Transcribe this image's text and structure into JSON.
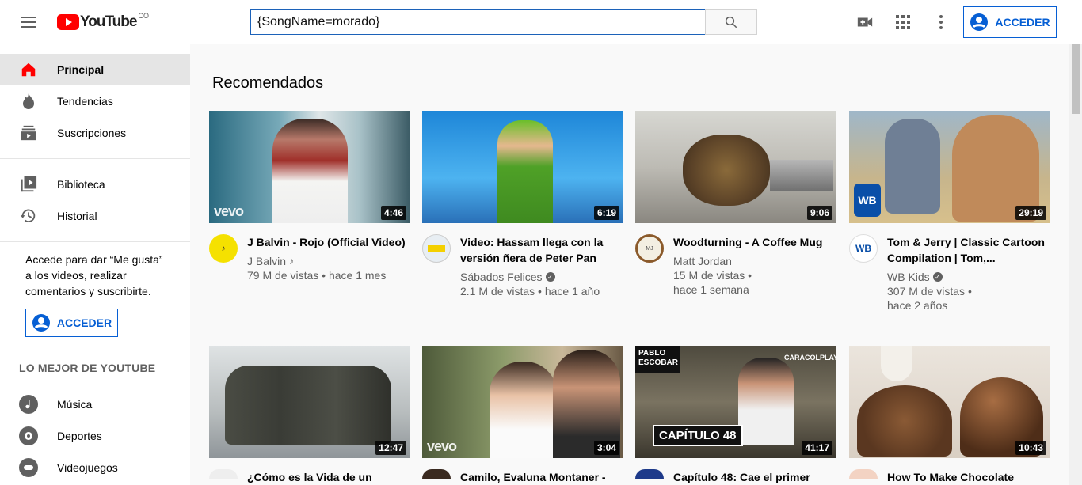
{
  "header": {
    "logo_text": "YouTube",
    "region": "CO",
    "search_value": "{SongName=morado}",
    "signin_label": "ACCEDER"
  },
  "sidebar": {
    "items": [
      {
        "label": "Principal",
        "icon": "home-icon"
      },
      {
        "label": "Tendencias",
        "icon": "trending-icon"
      },
      {
        "label": "Suscripciones",
        "icon": "subscriptions-icon"
      }
    ],
    "library_items": [
      {
        "label": "Biblioteca",
        "icon": "library-icon"
      },
      {
        "label": "Historial",
        "icon": "history-icon"
      }
    ],
    "signin_message": "Accede para dar “Me gusta” a los videos, realizar comentarios y suscribirte.",
    "signin_label": "ACCEDER",
    "best_heading": "LO MEJOR DE YOUTUBE",
    "best_items": [
      {
        "label": "Música",
        "icon": "music-icon"
      },
      {
        "label": "Deportes",
        "icon": "sports-icon"
      },
      {
        "label": "Videojuegos",
        "icon": "gaming-icon"
      }
    ]
  },
  "main": {
    "section_title": "Recomendados",
    "videos": [
      {
        "title": "J Balvin - Rojo (Official Video)",
        "channel": "J Balvin",
        "channel_badge": "music-note",
        "views": "79 M de vistas",
        "age": "hace 1 mes",
        "duration": "4:46",
        "vevo": "vevo"
      },
      {
        "title": "Video: Hassam llega con la versión ñera de Peter Pan",
        "channel": "Sábados Felices",
        "channel_badge": "verified",
        "views": "2.1 M de vistas",
        "age": "hace 1 año",
        "duration": "6:19"
      },
      {
        "title": "Woodturning - A Coffee Mug",
        "channel": "Matt Jordan",
        "views": "15 M de vistas",
        "age": "hace 1 semana",
        "duration": "9:06"
      },
      {
        "title": "Tom & Jerry | Classic Cartoon Compilation | Tom,...",
        "channel": "WB Kids",
        "channel_badge": "verified",
        "views": "307 M de vistas",
        "age": "hace 2 años",
        "duration": "29:19"
      },
      {
        "title": "¿Cómo es la Vida de un",
        "duration": "12:47"
      },
      {
        "title": "Camilo, Evaluna Montaner -",
        "duration": "3:04",
        "vevo": "vevo"
      },
      {
        "title": "Capítulo 48: Cae el primer",
        "duration": "41:17",
        "thumb_text_1": "PABLO ESCOBAR",
        "thumb_text_2": "CAPÍTULO 48",
        "thumb_text_3": "CARACOLPLAY"
      },
      {
        "title": "How To Make Chocolate",
        "duration": "10:43"
      }
    ]
  },
  "colors": {
    "accent": "#065fd4",
    "brand": "#ff0000"
  }
}
